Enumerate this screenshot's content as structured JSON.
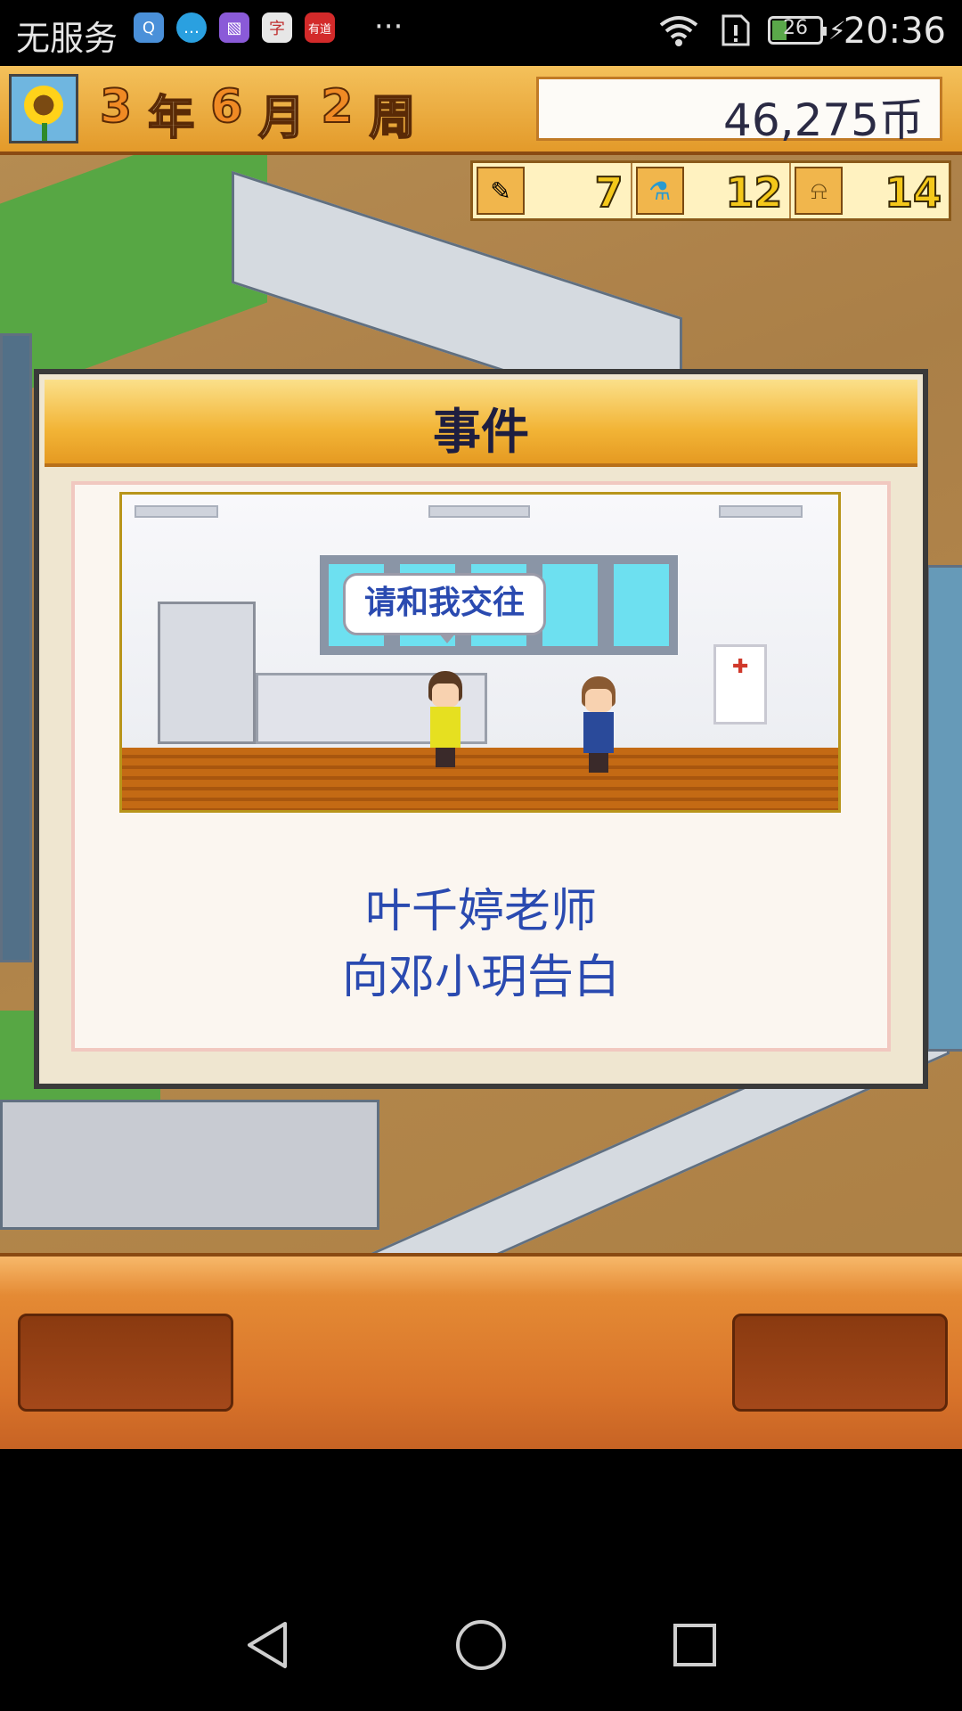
{
  "status_bar": {
    "carrier": "无服务",
    "notification_icons": [
      "qq-icon",
      "message-icon",
      "gallery-icon",
      "dictionary-icon",
      "youdao-icon"
    ],
    "notification_labels": [
      "Q",
      "…",
      "▧",
      "字",
      "有道"
    ],
    "more": "···",
    "battery": "26",
    "time": "20:36"
  },
  "hud": {
    "year": "3",
    "year_unit": "年",
    "month": "6",
    "month_unit": "月",
    "week": "2",
    "week_unit": "周",
    "money": "46,275币",
    "stats": [
      {
        "icon": "pencil-icon",
        "value": "7"
      },
      {
        "icon": "flask-icon",
        "value": "12"
      },
      {
        "icon": "bell-icon",
        "value": "14"
      }
    ]
  },
  "dialog": {
    "title": "事件",
    "speech": "请和我交往",
    "message_line1": "叶千婷老师",
    "message_line2": "向邓小玥告白"
  },
  "colors": {
    "accent_orange": "#e48a34",
    "header_gold": "#f2b436",
    "message_blue": "#2a4ab0",
    "title_navy": "#1e1e40"
  },
  "navigation": [
    "back-icon",
    "home-icon",
    "recents-icon"
  ]
}
